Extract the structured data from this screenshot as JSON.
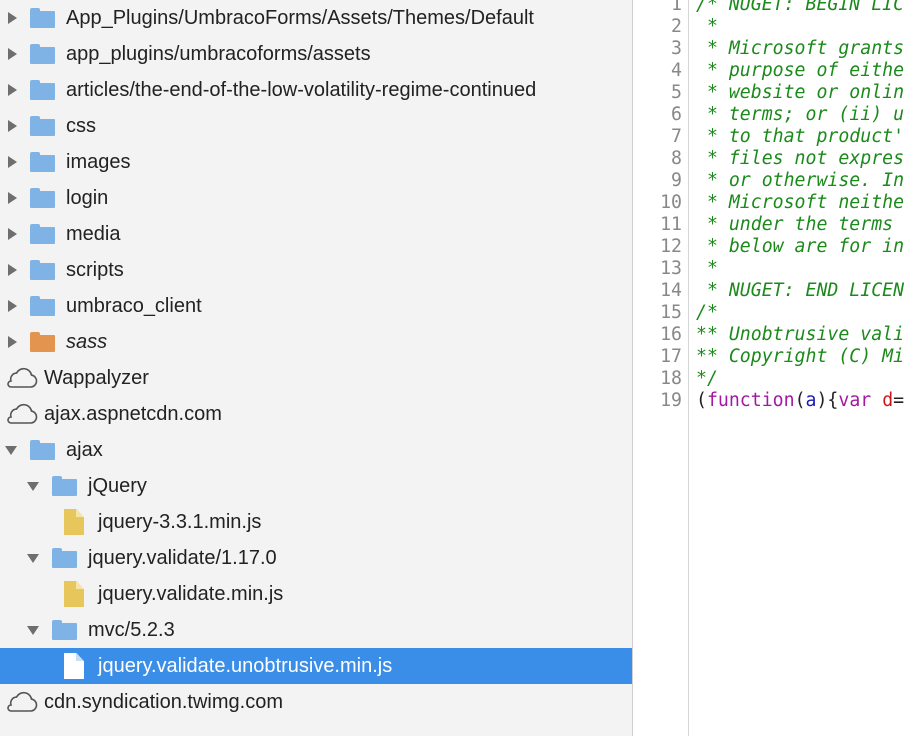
{
  "tree": {
    "items": [
      {
        "label": "App_Plugins/UmbracoForms/Assets/Themes/Default",
        "kind": "folder",
        "color": "blue",
        "arrow": "right"
      },
      {
        "label": "app_plugins/umbracoforms/assets",
        "kind": "folder",
        "color": "blue",
        "arrow": "right"
      },
      {
        "label": "articles/the-end-of-the-low-volatility-regime-continued",
        "kind": "folder",
        "color": "blue",
        "arrow": "right"
      },
      {
        "label": "css",
        "kind": "folder",
        "color": "blue",
        "arrow": "right"
      },
      {
        "label": "images",
        "kind": "folder",
        "color": "blue",
        "arrow": "right"
      },
      {
        "label": "login",
        "kind": "folder",
        "color": "blue",
        "arrow": "right"
      },
      {
        "label": "media",
        "kind": "folder",
        "color": "blue",
        "arrow": "right"
      },
      {
        "label": "scripts",
        "kind": "folder",
        "color": "blue",
        "arrow": "right"
      },
      {
        "label": "umbraco_client",
        "kind": "folder",
        "color": "blue",
        "arrow": "right"
      },
      {
        "label": "sass",
        "kind": "folder",
        "color": "orange",
        "arrow": "right",
        "italic": true
      },
      {
        "label": "Wappalyzer",
        "kind": "cloud"
      },
      {
        "label": "ajax.aspnetcdn.com",
        "kind": "cloud"
      },
      {
        "label": "ajax",
        "kind": "folder",
        "color": "blue",
        "arrow": "down"
      },
      {
        "label": "jQuery",
        "kind": "folder",
        "color": "blue",
        "arrow": "down"
      },
      {
        "label": "jquery-3.3.1.min.js",
        "kind": "file",
        "filetype": "js"
      },
      {
        "label": "jquery.validate/1.17.0",
        "kind": "folder",
        "color": "blue",
        "arrow": "down"
      },
      {
        "label": "jquery.validate.min.js",
        "kind": "file",
        "filetype": "js"
      },
      {
        "label": "mvc/5.2.3",
        "kind": "folder",
        "color": "blue",
        "arrow": "down"
      },
      {
        "label": "jquery.validate.unobtrusive.min.js",
        "kind": "file",
        "filetype": "white",
        "selected": true
      },
      {
        "label": "cdn.syndication.twimg.com",
        "kind": "cloud"
      }
    ]
  },
  "code": {
    "lines": [
      {
        "n": "1",
        "parts": [
          {
            "t": "/* NUGET: BEGIN LIC",
            "c": "cm"
          }
        ]
      },
      {
        "n": "2",
        "parts": [
          {
            "t": " *",
            "c": "cm"
          }
        ]
      },
      {
        "n": "3",
        "parts": [
          {
            "t": " * Microsoft grants",
            "c": "cm"
          }
        ]
      },
      {
        "n": "4",
        "parts": [
          {
            "t": " * purpose of eithe",
            "c": "cm"
          }
        ]
      },
      {
        "n": "5",
        "parts": [
          {
            "t": " * website or onlin",
            "c": "cm"
          }
        ]
      },
      {
        "n": "6",
        "parts": [
          {
            "t": " * terms; or (ii) u",
            "c": "cm"
          }
        ]
      },
      {
        "n": "7",
        "parts": [
          {
            "t": " * to that product'",
            "c": "cm"
          }
        ]
      },
      {
        "n": "8",
        "parts": [
          {
            "t": " * files not expres",
            "c": "cm"
          }
        ]
      },
      {
        "n": "9",
        "parts": [
          {
            "t": " * or otherwise. In",
            "c": "cm"
          }
        ]
      },
      {
        "n": "10",
        "parts": [
          {
            "t": " * Microsoft neithe",
            "c": "cm"
          }
        ]
      },
      {
        "n": "11",
        "parts": [
          {
            "t": " * under the terms ",
            "c": "cm"
          }
        ]
      },
      {
        "n": "12",
        "parts": [
          {
            "t": " * below are for in",
            "c": "cm"
          }
        ]
      },
      {
        "n": "13",
        "parts": [
          {
            "t": " *",
            "c": "cm"
          }
        ]
      },
      {
        "n": "14",
        "parts": [
          {
            "t": " * NUGET: END LICEN",
            "c": "cm"
          }
        ]
      },
      {
        "n": "15",
        "parts": [
          {
            "t": "/*",
            "c": "cm"
          }
        ]
      },
      {
        "n": "16",
        "parts": [
          {
            "t": "** Unobtrusive vali",
            "c": "cm"
          }
        ]
      },
      {
        "n": "17",
        "parts": [
          {
            "t": "** Copyright (C) Mi",
            "c": "cm"
          }
        ]
      },
      {
        "n": "18",
        "parts": [
          {
            "t": "*/",
            "c": "cm"
          }
        ]
      },
      {
        "n": "19",
        "parts": [
          {
            "t": "(",
            "c": "pl"
          },
          {
            "t": "function",
            "c": "kw"
          },
          {
            "t": "(",
            "c": "pl"
          },
          {
            "t": "a",
            "c": "id"
          },
          {
            "t": "){",
            "c": "pl"
          },
          {
            "t": "var",
            "c": "kw"
          },
          {
            "t": " ",
            "c": "pl"
          },
          {
            "t": "d",
            "c": "vn"
          },
          {
            "t": "=",
            "c": "pl"
          }
        ]
      }
    ]
  }
}
